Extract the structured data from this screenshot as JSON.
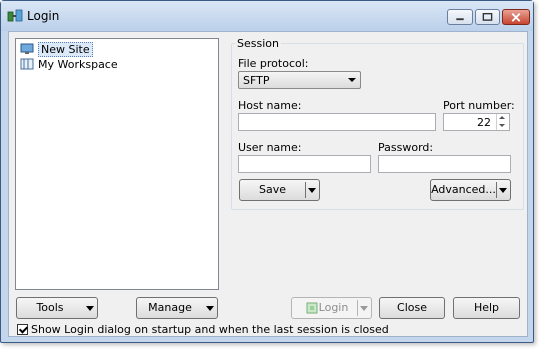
{
  "window": {
    "title": "Login"
  },
  "sites": [
    {
      "label": "New Site",
      "selected": true
    },
    {
      "label": "My Workspace",
      "selected": false
    }
  ],
  "session": {
    "legend": "Session",
    "file_protocol_label": "File protocol:",
    "file_protocol_value": "SFTP",
    "host_label": "Host name:",
    "host_value": "",
    "port_label": "Port number:",
    "port_value": "22",
    "user_label": "User name:",
    "user_value": "",
    "password_label": "Password:",
    "password_value": "",
    "save_label": "Save",
    "advanced_label": "Advanced..."
  },
  "footer": {
    "tools_label": "Tools",
    "manage_label": "Manage",
    "login_label": "Login",
    "close_label": "Close",
    "help_label": "Help",
    "startup_checkbox_label": "Show Login dialog on startup and when the last session is closed",
    "startup_checked": true
  }
}
